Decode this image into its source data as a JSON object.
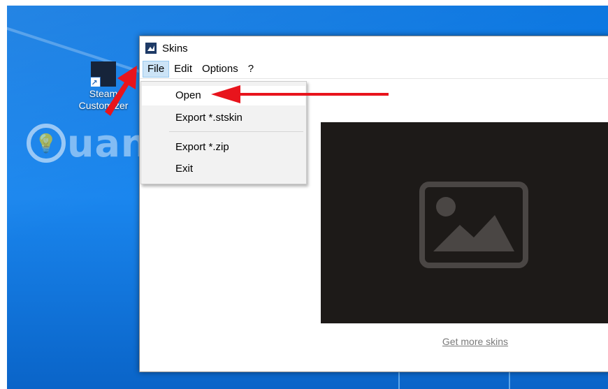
{
  "desktop": {
    "shortcut_label": "Steam Customizer",
    "watermark_text": "uantrimang"
  },
  "window": {
    "title": "Skins",
    "menu": [
      "File",
      "Edit",
      "Options",
      "?"
    ],
    "active_menu": "File"
  },
  "file_menu": {
    "items": [
      {
        "label": "Open",
        "hovered": true
      },
      {
        "label": "Export *.stskin",
        "hovered": false
      },
      {
        "label": "Export *.zip",
        "hovered": false
      },
      {
        "label": "Exit",
        "hovered": false
      }
    ]
  },
  "preview": {
    "link": "Get more skins",
    "icon": "image-placeholder-icon"
  },
  "colors": {
    "annotation": "#e8141c",
    "menu_highlight": "#cce4f7",
    "preview_bg": "#1d1a18"
  }
}
